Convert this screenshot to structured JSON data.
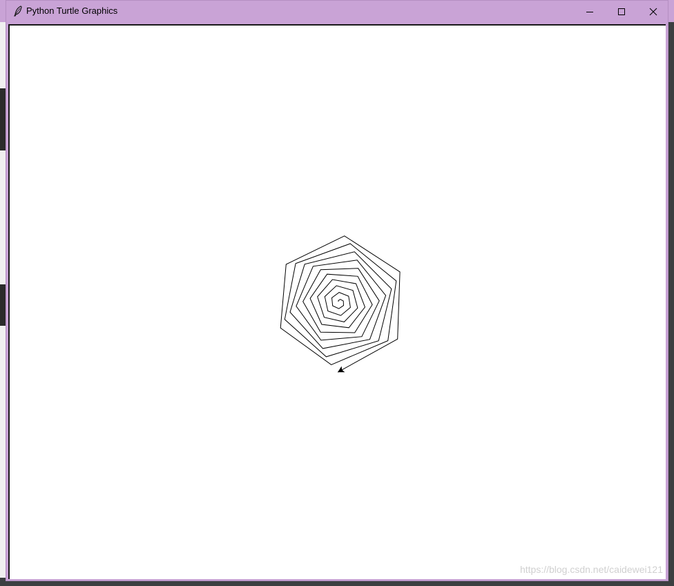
{
  "window": {
    "title": "Python Turtle Graphics"
  },
  "controls": {
    "minimize_icon": "minimize-icon",
    "maximize_icon": "maximize-icon",
    "close_icon": "close-icon"
  },
  "colors": {
    "titlebar": "#c9a3d6",
    "canvas": "#ffffff",
    "pen": "#000000"
  },
  "turtle": {
    "shape": "arrow",
    "pen_color": "#000000",
    "figure": "hexagonal spiral"
  },
  "watermark": "https://blog.csdn.net/caidewei121"
}
